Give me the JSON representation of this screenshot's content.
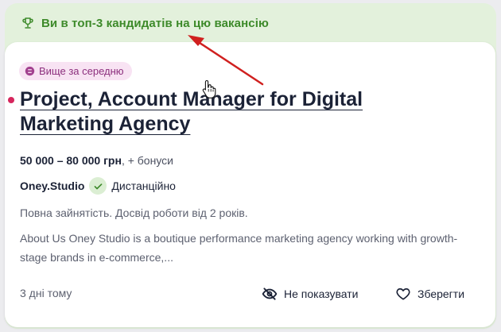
{
  "banner": {
    "icon": "trophy-icon",
    "text": "Ви в топ-3 кандидатів на цю вакансію",
    "color": "#3d8a2a"
  },
  "card": {
    "badge": {
      "icon": "coin-icon",
      "text": "Вище за середню",
      "color": "#8c2f7d"
    },
    "title": "Project, Account Manager for Digital Marketing Agency",
    "salary": {
      "amount": "50 000 – 80 000 грн",
      "extra": ", + бонуси"
    },
    "company": {
      "name": "Oney.Studio",
      "verified_icon": "check-icon",
      "location": "Дистанційно"
    },
    "conditions": "Повна зайнятість. Досвід роботи від 2 років.",
    "description": "About Us Oney Studio is a boutique performance marketing agency working with growth-stage brands in e-commerce,...",
    "posted": "3 дні тому",
    "actions": {
      "hide": {
        "icon": "eye-off-icon",
        "label": "Не показувати"
      },
      "save": {
        "icon": "heart-icon",
        "label": "Зберегти"
      }
    }
  },
  "colors": {
    "accent_red": "#d6265d",
    "title": "#1b2236",
    "banner_bg": "#e3f1dc",
    "annotation_arrow": "#d0201f"
  }
}
